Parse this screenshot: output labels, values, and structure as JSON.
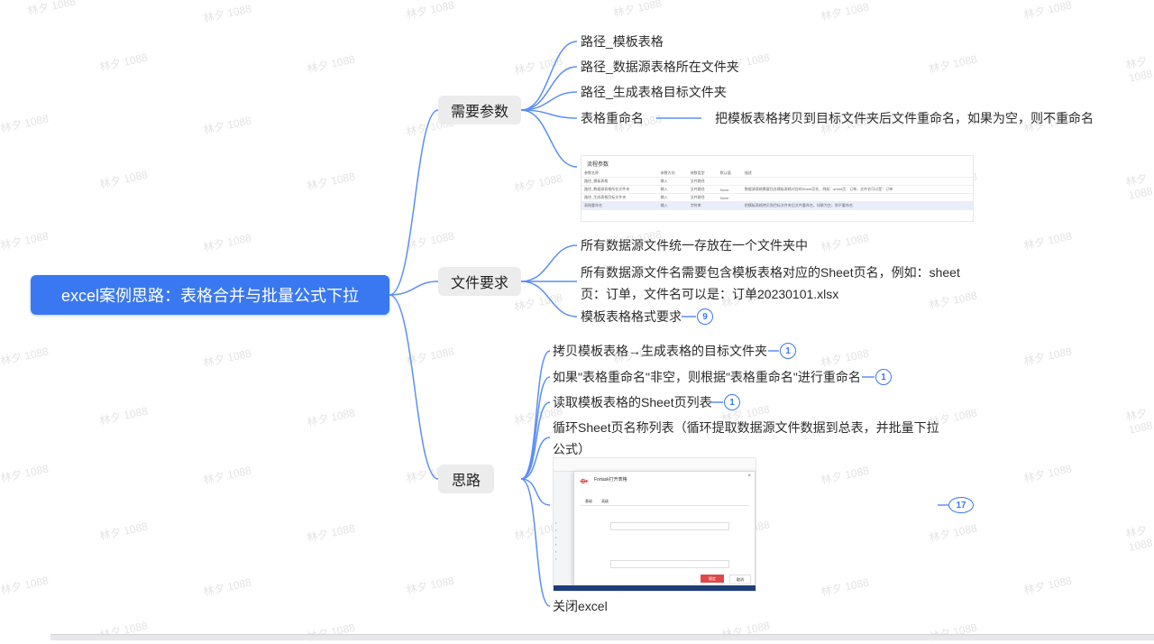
{
  "watermark": "林夕 1088",
  "root": {
    "label": "excel案例思路：表格合并与批量公式下拉"
  },
  "branches": {
    "params": {
      "label": "需要参数",
      "items": [
        "路径_模板表格",
        "路径_数据源表格所在文件夹",
        "路径_生成表格目标文件夹",
        "表格重命名"
      ],
      "note": "把模板表格拷贝到目标文件夹后文件重命名，如果为空，则不重命名",
      "thumb": {
        "title": "流程参数",
        "rows": [
          [
            "参数名称",
            "参数方向",
            "参数类型",
            "默认值",
            "描述"
          ],
          [
            "路径_模板表格",
            "输入",
            "文件路径",
            "",
            ""
          ],
          [
            "路径_数据源表格所在文件夹",
            "输入",
            "文件路径",
            "None",
            "数据源表格需要包含模板表格对应的Sheet页名，例如：sheet页：订单，文件名可以是：订单"
          ],
          [
            "路径_生成表格目标文件夹",
            "输入",
            "文件路径",
            "None",
            ""
          ],
          [
            "表格重命名",
            "输入",
            "字符串",
            "",
            "把模板表格拷贝到目标文件夹后文件重命名，如果为空，则不重命名"
          ]
        ]
      }
    },
    "files": {
      "label": "文件要求",
      "items": [
        "所有数据源文件统一存放在一个文件夹中",
        "所有数据源文件名需要包含模板表格对应的Sheet页名，例如：sheet页：订单，文件名可以是：订单20230101.xlsx",
        "模板表格格式要求"
      ],
      "badges": [
        "9"
      ]
    },
    "ideas": {
      "label": "思路",
      "items": [
        "拷贝模板表格→生成表格的目标文件夹",
        "如果\"表格重命名\"非空，则根据\"表格重命名\"进行重命名",
        "读取模板表格的Sheet页列表",
        "循环Sheet页名称列表（循环提取数据源文件数据到总表，并批量下拉公式）",
        "关闭excel"
      ],
      "badges": [
        "1",
        "1",
        "1",
        "17"
      ],
      "dialog": {
        "title": "Fortask打开表格",
        "tabs": [
          "基础",
          "高级"
        ],
        "ok": "确定",
        "cancel": "取消"
      }
    }
  },
  "colors": {
    "accent": "#3a78f2",
    "branch_bg": "#ececec",
    "line": "#5b8ff5"
  }
}
